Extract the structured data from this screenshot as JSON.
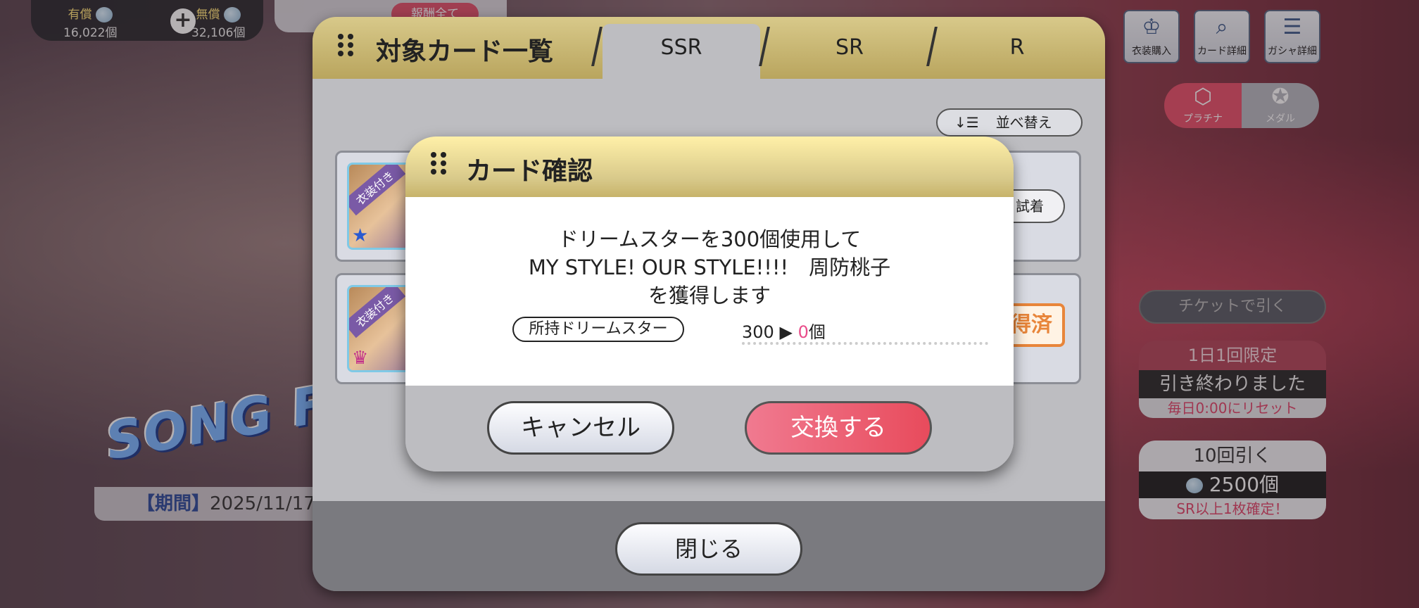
{
  "currency": {
    "paid_label": "有償",
    "paid_amount": "16,022個",
    "free_label": "無償",
    "free_amount": "32,106個",
    "reward_all": "報酬全て"
  },
  "right_menu": {
    "costume_buy": "衣装購入",
    "card_detail": "カード詳細",
    "gacha_detail": "ガシャ詳細",
    "platina": "プラチナ",
    "medal": "メダル",
    "ticket_draw": "チケットで引く",
    "daily_limit": "1日1回限定",
    "daily_done": "引き終わりました",
    "daily_reset": "毎日0:00にリセット",
    "ten_draw": "10回引く",
    "ten_cost": "2500個",
    "ten_guarantee": "SR以上1枚確定！"
  },
  "event": {
    "logo": "SONG FOR",
    "period_label": "【期間】",
    "period_value": "2025/11/17"
  },
  "list_panel": {
    "title": "対象カード一覧",
    "tabs": [
      "SSR",
      "SR",
      "R"
    ],
    "active_tab": "SSR",
    "sort_label": "並べ替え",
    "cards": [
      {
        "badge": "衣装付き",
        "action": "試着"
      },
      {
        "badge": "衣装付き",
        "action": "得済"
      }
    ],
    "close_label": "閉じる"
  },
  "dialog": {
    "title": "カード確認",
    "message_line1": "ドリームスターを300個使用して",
    "message_line2": "MY STYLE! OUR STYLE!!!!　周防桃子",
    "message_line3": "を獲得します",
    "owned_label": "所持ドリームスター",
    "owned_before": "300",
    "owned_arrow": "▶",
    "owned_after": "0",
    "owned_unit": "個",
    "cancel_label": "キャンセル",
    "confirm_label": "交換する"
  },
  "colors": {
    "accent_pink": "#e84b5c",
    "header_gold": "#d8c98a",
    "after_value": "#e94d8a"
  }
}
